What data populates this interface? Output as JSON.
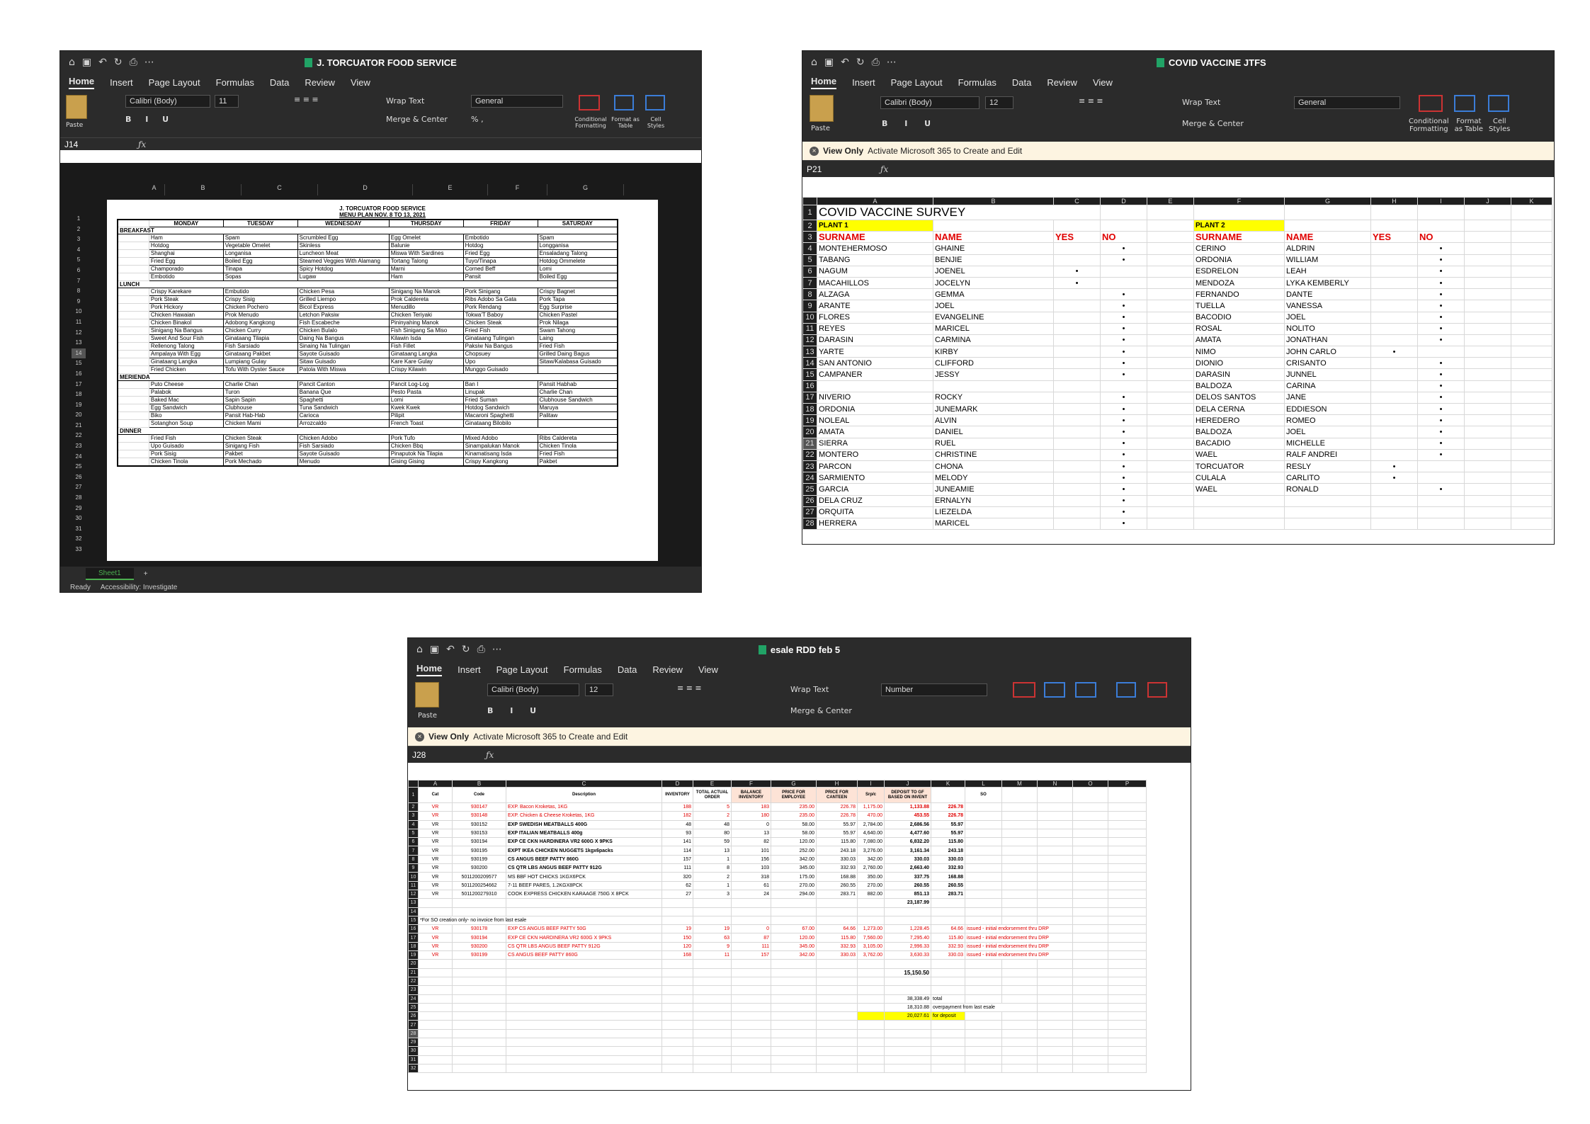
{
  "menu_window": {
    "title": "J. TORCUATOR FOOD SERVICE",
    "tabs": [
      "Home",
      "Insert",
      "Page Layout",
      "Formulas",
      "Data",
      "Review",
      "View"
    ],
    "font": "Calibri (Body)",
    "size": "11",
    "number_format": "General",
    "wrap": "Wrap Text",
    "merge": "Merge & Center",
    "paste": "Paste",
    "cond": "Conditional Formatting",
    "fmt_table": "Format as Table",
    "cell_styles": "Cell Styles",
    "cell_ref": "J14",
    "columns": [
      "A",
      "B",
      "C",
      "D",
      "E",
      "F",
      "G"
    ],
    "doc_title": "J. TORCUATOR FOOD SERVICE",
    "doc_subtitle": "MENU PLAN NOV. 8 TO 13, 2021",
    "days": [
      "MONDAY",
      "TUESDAY",
      "WEDNESDAY",
      "THURSDAY",
      "FRIDAY",
      "SATURDAY"
    ],
    "sections": [
      {
        "name": "BREAKFAST",
        "rows": [
          [
            "Ham",
            "Spam",
            "Scrumbled Egg",
            "Egg Omelet",
            "Embotido",
            "Spam"
          ],
          [
            "Hotdog",
            "Vegetable Omelet",
            "Skinless",
            "Balunie",
            "Hotdog",
            "Longganisa"
          ],
          [
            "Shanghai",
            "Longanisa",
            "Luncheon Meat",
            "Miswa With Sardines",
            "Fried Egg",
            "Ensaladang Talong"
          ],
          [
            "Fried Egg",
            "Boiled Egg",
            "Steamed Veggies With Alamang",
            "Tortang Talong",
            "Tuyo/Tinapa",
            "Hotdog Ommelete"
          ],
          [
            "Champorado",
            "Tinapa",
            "Spicy Hotdog",
            "Marni",
            "Corned Beff",
            "Lomi"
          ],
          [
            "Embotido",
            "Sopas",
            "Lugaw",
            "Ham",
            "Pansit",
            "Boiled Egg"
          ]
        ]
      },
      {
        "name": "LUNCH",
        "rows": [
          [
            "Crispy Karekare",
            "Embutido",
            "Chicken Pesa",
            "Sinigang Na Manok",
            "Pork Sinigang",
            "Crispy Bagnet"
          ],
          [
            "Pork Steak",
            "Crispy Sisig",
            "Grilled Liempo",
            "Prok Caldereta",
            "Ribs Adobo Sa Gata",
            "Pork Tapa"
          ],
          [
            "Pork Hickory",
            "Chicken Pochero",
            "Bicol Express",
            "Menudillo",
            "Pork Rendang",
            "Egg Surprise"
          ],
          [
            "Chicken Hawaian",
            "Prok Menudo",
            "Letchon Paksiw",
            "Chicken Teriyaki",
            "Tokwa'T Baboy",
            "Chicken Pastel"
          ],
          [
            "Chicken Binakol",
            "Adobong Kangkong",
            "Fish Escabeche",
            "Pininyahing Manok",
            "Chicken Steak",
            "Prok Nilaga"
          ],
          [
            "Sinigang Na Bangus",
            "Chicken Curry",
            "Chicken Bulalo",
            "Fish Sinigang Sa Miso",
            "Fried Fish",
            "Swam Tahong"
          ],
          [
            "Sweet And Sour Fish",
            "Ginataang Tilapia",
            "Daing Na Bangus",
            "Kilawin Isda",
            "Ginataang Tulingan",
            "Laing"
          ],
          [
            "Rellenong Talong",
            "Fish Sarsiado",
            "Sinaing Na Tulingan",
            "Fish Fillet",
            "Paksiw Na Bangus",
            "Fried Fish"
          ],
          [
            "Ampalaya With Egg",
            "Ginataang Pakbet",
            "Sayote Guisado",
            "Ginataang Langka",
            "Chopsuey",
            "Grilled Daing Bagus"
          ],
          [
            "Ginataang Langka",
            "Lumpiang Gulay",
            "Sitaw Guisado",
            "Kare Kare Gulay",
            "Upo",
            "Sitaw/Kalabasa Guisado"
          ],
          [
            "Fried Chicken",
            "Tofu With Oyster Sauce",
            "Patola With Miswa",
            "Crispy Kilawin",
            "Munggo Guisado",
            ""
          ]
        ]
      },
      {
        "name": "MERIENDA",
        "rows": [
          [
            "Puto Cheese",
            "Charlie Chan",
            "Pancit Canton",
            "Pancit Log-Log",
            "Ban I",
            "Pansit Habhab"
          ],
          [
            "Palabok",
            "Turon",
            "Banana Que",
            "Pesto Pasta",
            "Linupak",
            "Charlie Chan"
          ],
          [
            "Baked Mac",
            "Sapin Sapin",
            "Spaghetti",
            "Lomi",
            "Fried Suman",
            "Clubhouse Sandwich"
          ],
          [
            "Egg Sandwich",
            "Clubhouse",
            "Tuna Sandwich",
            "Kwek Kwek",
            "Hotdog Sandwich",
            "Maruya"
          ],
          [
            "Biko",
            "Pansit Hab-Hab",
            "Carioca",
            "Pilipit",
            "Macaroni Spaghetti",
            "Palitaw"
          ],
          [
            "Sotanghon Soup",
            "Chicken Mami",
            "Arrozcaldo",
            "French Toast",
            "Ginataang Bilobilo",
            ""
          ]
        ]
      },
      {
        "name": "DINNER",
        "rows": [
          [
            "Fried Fish",
            "Chicken Steak",
            "Chicken Adobo",
            "Pork Tufo",
            "Mixed Adobo",
            "Ribs Caldereta"
          ],
          [
            "Upo Guisado",
            "Sinigang Fish",
            "Fish Sarsiado",
            "Chicken Bbq",
            "Sinampalukan Manok",
            "Chicken Tinola"
          ],
          [
            "Pork Sisig",
            "Pakbet",
            "Sayote Guisado",
            "Pinaputok Na Tilapia",
            "Kinamatisang Isda",
            "Fried Fish"
          ],
          [
            "Chicken Tinola",
            "Pork Mechado",
            "Menudo",
            "Gising Gising",
            "Crispy Kangkong",
            "Pakbet"
          ]
        ]
      }
    ],
    "sheet_tab": "Sheet1",
    "status_ready": "Ready",
    "status_access": "Accessibility: Investigate"
  },
  "vaccine_window": {
    "title": "COVID VACCINE JTFS",
    "tabs": [
      "Home",
      "Insert",
      "Page Layout",
      "Formulas",
      "Data",
      "Review",
      "View"
    ],
    "font": "Calibri (Body)",
    "size": "12",
    "number_format": "General",
    "view_only": "View Only",
    "view_only_msg": "Activate Microsoft 365 to Create and Edit",
    "cell_ref": "P21",
    "columns": [
      "A",
      "B",
      "C",
      "D",
      "E",
      "F",
      "G",
      "H",
      "I",
      "J",
      "K"
    ],
    "sheet_title": "COVID VACCINE SURVEY",
    "plant1": "PLANT 1",
    "plant2": "PLANT 2",
    "headers": [
      "SURNAME",
      "NAME",
      "YES",
      "NO"
    ],
    "bullet": "•",
    "plant1_rows": [
      [
        "MONTEHERMOSO",
        "GHAINE",
        "",
        "•"
      ],
      [
        "TABANG",
        "BENJIE",
        "",
        "•"
      ],
      [
        "NAGUM",
        "JOENEL",
        "•",
        ""
      ],
      [
        "MACAHILLOS",
        "JOCELYN",
        "•",
        ""
      ],
      [
        "ALZAGA",
        "GEMMA",
        "",
        "•"
      ],
      [
        "ARANTE",
        "JOEL",
        "",
        "•"
      ],
      [
        "FLORES",
        "EVANGELINE",
        "",
        "•"
      ],
      [
        "REYES",
        "MARICEL",
        "",
        "•"
      ],
      [
        "DARASIN",
        "CARMINA",
        "",
        "•"
      ],
      [
        "YARTE",
        "KIRBY",
        "",
        "•"
      ],
      [
        "SAN ANTONIO",
        "CLIFFORD",
        "",
        "•"
      ],
      [
        "CAMPANER",
        "JESSY",
        "",
        "•"
      ],
      [
        "",
        "",
        "",
        ""
      ],
      [
        "NIVERIO",
        "ROCKY",
        "",
        "•"
      ],
      [
        "ORDONIA",
        "JUNEMARK",
        "",
        "•"
      ],
      [
        "NOLEAL",
        "ALVIN",
        "",
        "•"
      ],
      [
        "AMATA",
        "DANIEL",
        "",
        "•"
      ],
      [
        "SIERRA",
        "RUEL",
        "",
        "•"
      ],
      [
        "MONTERO",
        "CHRISTINE",
        "",
        "•"
      ],
      [
        "PARCON",
        "CHONA",
        "",
        "•"
      ],
      [
        "SARMIENTO",
        "MELODY",
        "",
        "•"
      ],
      [
        "GARCIA",
        "JUNEAMIE",
        "",
        "•"
      ],
      [
        "DELA CRUZ",
        "ERNALYN",
        "",
        "•"
      ],
      [
        "ORQUITA",
        "LIEZELDA",
        "",
        "•"
      ],
      [
        "HERRERA",
        "MARICEL",
        "",
        "•"
      ]
    ],
    "plant2_rows": [
      [
        "CERINO",
        "ALDRIN",
        "",
        "•"
      ],
      [
        "ORDONIA",
        "WILLIAM",
        "",
        "•"
      ],
      [
        "ESDRELON",
        "LEAH",
        "",
        "•"
      ],
      [
        "MENDOZA",
        "LYKA KEMBERLY",
        "",
        "•"
      ],
      [
        "FERNANDO",
        "DANTE",
        "",
        "•"
      ],
      [
        "TUELLA",
        "VANESSA",
        "",
        "•"
      ],
      [
        "BACODIO",
        "JOEL",
        "",
        "•"
      ],
      [
        "ROSAL",
        "NOLITO",
        "",
        "•"
      ],
      [
        "AMATA",
        "JONATHAN",
        "",
        "•"
      ],
      [
        "NIMO",
        "JOHN CARLO",
        "•",
        ""
      ],
      [
        "DIONIO",
        "CRISANTO",
        "",
        "•"
      ],
      [
        "DARASIN",
        "JUNNEL",
        "",
        "•"
      ],
      [
        "BALDOZA",
        "CARINA",
        "",
        "•"
      ],
      [
        "DELOS SANTOS",
        "JANE",
        "",
        "•"
      ],
      [
        "DELA CERNA",
        "EDDIESON",
        "",
        "•"
      ],
      [
        "HEREDERO",
        "ROMEO",
        "",
        "•"
      ],
      [
        "BALDOZA",
        "JOEL",
        "",
        "•"
      ],
      [
        "BACADIO",
        "MICHELLE",
        "",
        "•"
      ],
      [
        "WAEL",
        "RALF ANDREI",
        "",
        "•"
      ],
      [
        "TORCUATOR",
        "RESLY",
        "•",
        ""
      ],
      [
        "CULALA",
        "CARLITO",
        "•",
        ""
      ],
      [
        "WAEL",
        "RONALD",
        "",
        "•"
      ],
      [
        "",
        "",
        "",
        ""
      ],
      [
        "",
        "",
        "",
        ""
      ],
      [
        "",
        "",
        "",
        ""
      ]
    ]
  },
  "esale_window": {
    "title": "esale RDD feb 5",
    "tabs": [
      "Home",
      "Insert",
      "Page Layout",
      "Formulas",
      "Data",
      "Review",
      "View"
    ],
    "font": "Calibri (Body)",
    "size": "12",
    "number_format": "Number",
    "view_only": "View Only",
    "view_only_msg": "Activate Microsoft 365 to Create and Edit",
    "cell_ref": "J28",
    "columns": [
      "A",
      "B",
      "C",
      "D",
      "E",
      "F",
      "G",
      "H",
      "I",
      "J",
      "K",
      "L",
      "M",
      "N",
      "O",
      "P"
    ],
    "headers": [
      "Cat",
      "Code",
      "Description",
      "INVENTORY",
      "TOTAL ACTUAL ORDER",
      "BALANCE INVENTORY",
      "PRICE FOR EMPLOYEE",
      "PRICE FOR CANTEEN",
      "Srp/c",
      "DEPOSIT TO GF BASED ON INVENT",
      "",
      "SO"
    ],
    "rows": [
      {
        "cells": [
          "VR",
          "930147",
          "EXP. Bacon Kroketas, 1KG",
          "188",
          "5",
          "183",
          "235.00",
          "226.78",
          "1,175.00",
          "1,133.88",
          "226.78"
        ],
        "style": "red"
      },
      {
        "cells": [
          "VR",
          "930148",
          "EXP. Chicken & Cheese Kroketas, 1KG",
          "182",
          "2",
          "180",
          "235.00",
          "226.78",
          "470.00",
          "453.55",
          "226.78"
        ],
        "style": "red"
      },
      {
        "cells": [
          "VR",
          "930152",
          "EXP SWEDISH MEATBALLS 400G",
          "48",
          "48",
          "0",
          "58.00",
          "55.97",
          "2,784.00",
          "2,686.56",
          "55.97"
        ],
        "style": "bold"
      },
      {
        "cells": [
          "VR",
          "930153",
          "EXP ITALIAN MEATBALLS 400g",
          "93",
          "80",
          "13",
          "58.00",
          "55.97",
          "4,640.00",
          "4,477.60",
          "55.97"
        ],
        "style": "bold"
      },
      {
        "cells": [
          "VR",
          "930194",
          "EXP CE CKN HARDINERA VR2 600G X 9PKS",
          "141",
          "59",
          "82",
          "120.00",
          "115.80",
          "7,080.00",
          "6,832.20",
          "115.80"
        ],
        "style": "bold"
      },
      {
        "cells": [
          "VR",
          "930195",
          "EXPT IKEA CHICKEN NUGGETS 1kgx6packs",
          "114",
          "13",
          "101",
          "252.00",
          "243.18",
          "3,276.00",
          "3,161.34",
          "243.18"
        ],
        "style": "bold"
      },
      {
        "cells": [
          "VR",
          "930199",
          "CS ANGUS BEEF PATTY 860G",
          "157",
          "1",
          "156",
          "342.00",
          "330.03",
          "342.00",
          "330.03",
          "330.03"
        ],
        "style": "bold"
      },
      {
        "cells": [
          "VR",
          "930200",
          "CS QTR LBS ANGUS BEEF PATTY 912G",
          "111",
          "8",
          "103",
          "345.00",
          "332.93",
          "2,760.00",
          "2,663.40",
          "332.93"
        ],
        "style": "bold"
      },
      {
        "cells": [
          "VR",
          "5011200209577",
          "MS BBF HOT CHICKS 1KGX6PCK",
          "320",
          "2",
          "318",
          "175.00",
          "168.88",
          "350.00",
          "337.75",
          "168.88"
        ],
        "style": "normal"
      },
      {
        "cells": [
          "VR",
          "5011200254662",
          "7-11 BEEF PARES, 1.2KGX8PCK",
          "62",
          "1",
          "61",
          "270.00",
          "260.55",
          "270.00",
          "260.55",
          "260.55"
        ],
        "style": "normal"
      },
      {
        "cells": [
          "VR",
          "5011200279310",
          "COOK EXPRESS CHICKEN KARAAGE 750G X 8PCK",
          "27",
          "3",
          "24",
          "294.00",
          "283.71",
          "882.00",
          "851.13",
          "283.71"
        ],
        "style": "normal"
      }
    ],
    "subtotal1": "23,187.99",
    "note": "*For SO creation only- no invoice from last esale",
    "rows2": [
      [
        "VR",
        "930178",
        "EXP CS ANGUS BEEF PATTY 50G",
        "19",
        "19",
        "0",
        "67.00",
        "64.66",
        "1,273.00",
        "1,228.45",
        "64.66",
        "issued - initial endorsement thru DRP"
      ],
      [
        "VR",
        "930194",
        "EXP CE CKN HARDINERA VR2 600G X 9PKS",
        "150",
        "63",
        "87",
        "120.00",
        "115.80",
        "7,560.00",
        "7,295.40",
        "115.80",
        "issued - initial endorsement thru DRP"
      ],
      [
        "VR",
        "930200",
        "CS QTR LBS ANGUS BEEF PATTY 912G",
        "120",
        "9",
        "111",
        "345.00",
        "332.93",
        "3,105.00",
        "2,996.33",
        "332.93",
        "issued - initial endorsement thru DRP"
      ],
      [
        "VR",
        "930199",
        "CS ANGUS BEEF PATTY 860G",
        "168",
        "11",
        "157",
        "342.00",
        "330.03",
        "3,762.00",
        "3,630.33",
        "330.03",
        "issued - initial endorsement thru DRP"
      ]
    ],
    "subtotal2": "15,150.50",
    "total": "38,338.49",
    "total_label": "total",
    "overpay": "18,310.88",
    "overpay_label": "overpayment from last esale",
    "deposit": "20,027.61",
    "deposit_label": "for deposit"
  }
}
